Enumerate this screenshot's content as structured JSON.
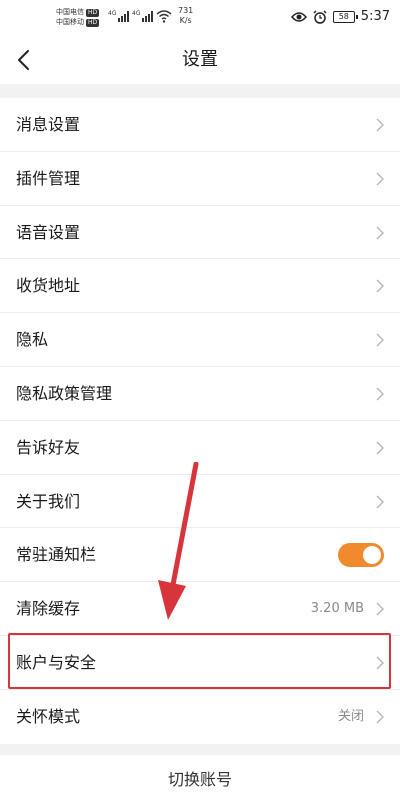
{
  "status_bar": {
    "carrier_1": "中国电信",
    "carrier_2": "中国移动",
    "hd_badge": "HD",
    "signal_tag": "4G",
    "net_speed_value": "731",
    "net_speed_unit": "K/s",
    "battery": "58",
    "time": "5:37"
  },
  "header": {
    "title": "设置"
  },
  "settings": {
    "items": [
      {
        "label": "消息设置"
      },
      {
        "label": "插件管理"
      },
      {
        "label": "语音设置"
      },
      {
        "label": "收货地址"
      },
      {
        "label": "隐私"
      },
      {
        "label": "隐私政策管理"
      },
      {
        "label": "告诉好友"
      },
      {
        "label": "关于我们"
      },
      {
        "label": "常驻通知栏",
        "toggle_on": true
      },
      {
        "label": "清除缓存",
        "value": "3.20 MB"
      },
      {
        "label": "账户与安全"
      },
      {
        "label": "关怀模式",
        "value": "关闭"
      }
    ]
  },
  "footer": {
    "switch_account": "切换账号"
  },
  "colors": {
    "accent": "#f08a2c",
    "highlight": "#d8343c"
  }
}
